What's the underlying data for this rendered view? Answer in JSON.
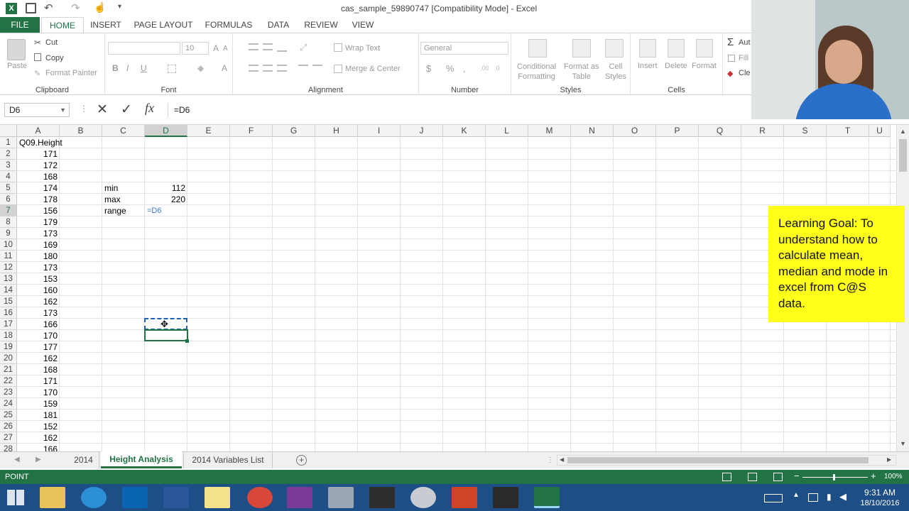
{
  "title_bar": {
    "title": "cas_sample_59890747  [Compatibility Mode] - Excel"
  },
  "ribbon_tabs": [
    "FILE",
    "HOME",
    "INSERT",
    "PAGE LAYOUT",
    "FORMULAS",
    "DATA",
    "REVIEW",
    "VIEW"
  ],
  "active_tab": "HOME",
  "ribbon": {
    "clipboard": {
      "paste": "Paste",
      "cut": "Cut",
      "copy": "Copy",
      "format_painter": "Format Painter",
      "label": "Clipboard"
    },
    "font": {
      "size": "10",
      "label": "Font",
      "bold": "B",
      "italic": "I",
      "underline": "U",
      "grow": "A",
      "shrink": "A",
      "color": "A"
    },
    "alignment": {
      "wrap": "Wrap Text",
      "merge": "Merge & Center",
      "label": "Alignment"
    },
    "number": {
      "format": "General",
      "currency": "$",
      "percent": "%",
      "comma": ",",
      "label": "Number"
    },
    "styles": {
      "conditional": "Conditional",
      "conditional2": "Formatting",
      "format_table": "Format as",
      "format_table2": "Table",
      "cell_styles": "Cell",
      "cell_styles2": "Styles",
      "label": "Styles"
    },
    "cells": {
      "insert": "Insert",
      "delete": "Delete",
      "format": "Format",
      "label": "Cells"
    },
    "editing": {
      "autosum": "Aut",
      "fill": "Fill",
      "clear": "Cle"
    }
  },
  "formula_bar": {
    "name_box": "D6",
    "formula": "=D6"
  },
  "columns": [
    "A",
    "B",
    "C",
    "D",
    "E",
    "F",
    "G",
    "H",
    "I",
    "J",
    "K",
    "L",
    "M",
    "N",
    "O",
    "P",
    "Q",
    "R",
    "S",
    "T",
    "U"
  ],
  "rows": [
    "1",
    "2",
    "3",
    "4",
    "5",
    "6",
    "7",
    "8",
    "9",
    "10",
    "11",
    "12",
    "13",
    "14",
    "15",
    "16",
    "17",
    "18",
    "19",
    "20",
    "21",
    "22",
    "23",
    "24",
    "25",
    "26",
    "27",
    "28"
  ],
  "column_a": [
    "Q09.Height",
    "171",
    "172",
    "168",
    "174",
    "178",
    "156",
    "179",
    "173",
    "169",
    "180",
    "173",
    "153",
    "160",
    "162",
    "173",
    "166",
    "170",
    "177",
    "162",
    "168",
    "171",
    "170",
    "159",
    "181",
    "152",
    "162",
    "166"
  ],
  "column_c": {
    "5": "min",
    "6": "max",
    "7": "range"
  },
  "column_d": {
    "5": "112",
    "6": "220",
    "7": "=D6"
  },
  "sheet_tabs": [
    "2014",
    "Height Analysis",
    "2014 Variables List"
  ],
  "active_sheet": "Height Analysis",
  "status": {
    "mode": "POINT",
    "zoom": "100%"
  },
  "learning_goal": "Learning Goal: To understand how to calculate mean, median and mode in excel from C@S data.",
  "taskbar": {
    "time": "9:31 AM",
    "date": "18/10/2016"
  },
  "colors": {
    "excel_green": "#217346",
    "highlight": "#ffff19",
    "taskbar": "#1d4e86"
  }
}
